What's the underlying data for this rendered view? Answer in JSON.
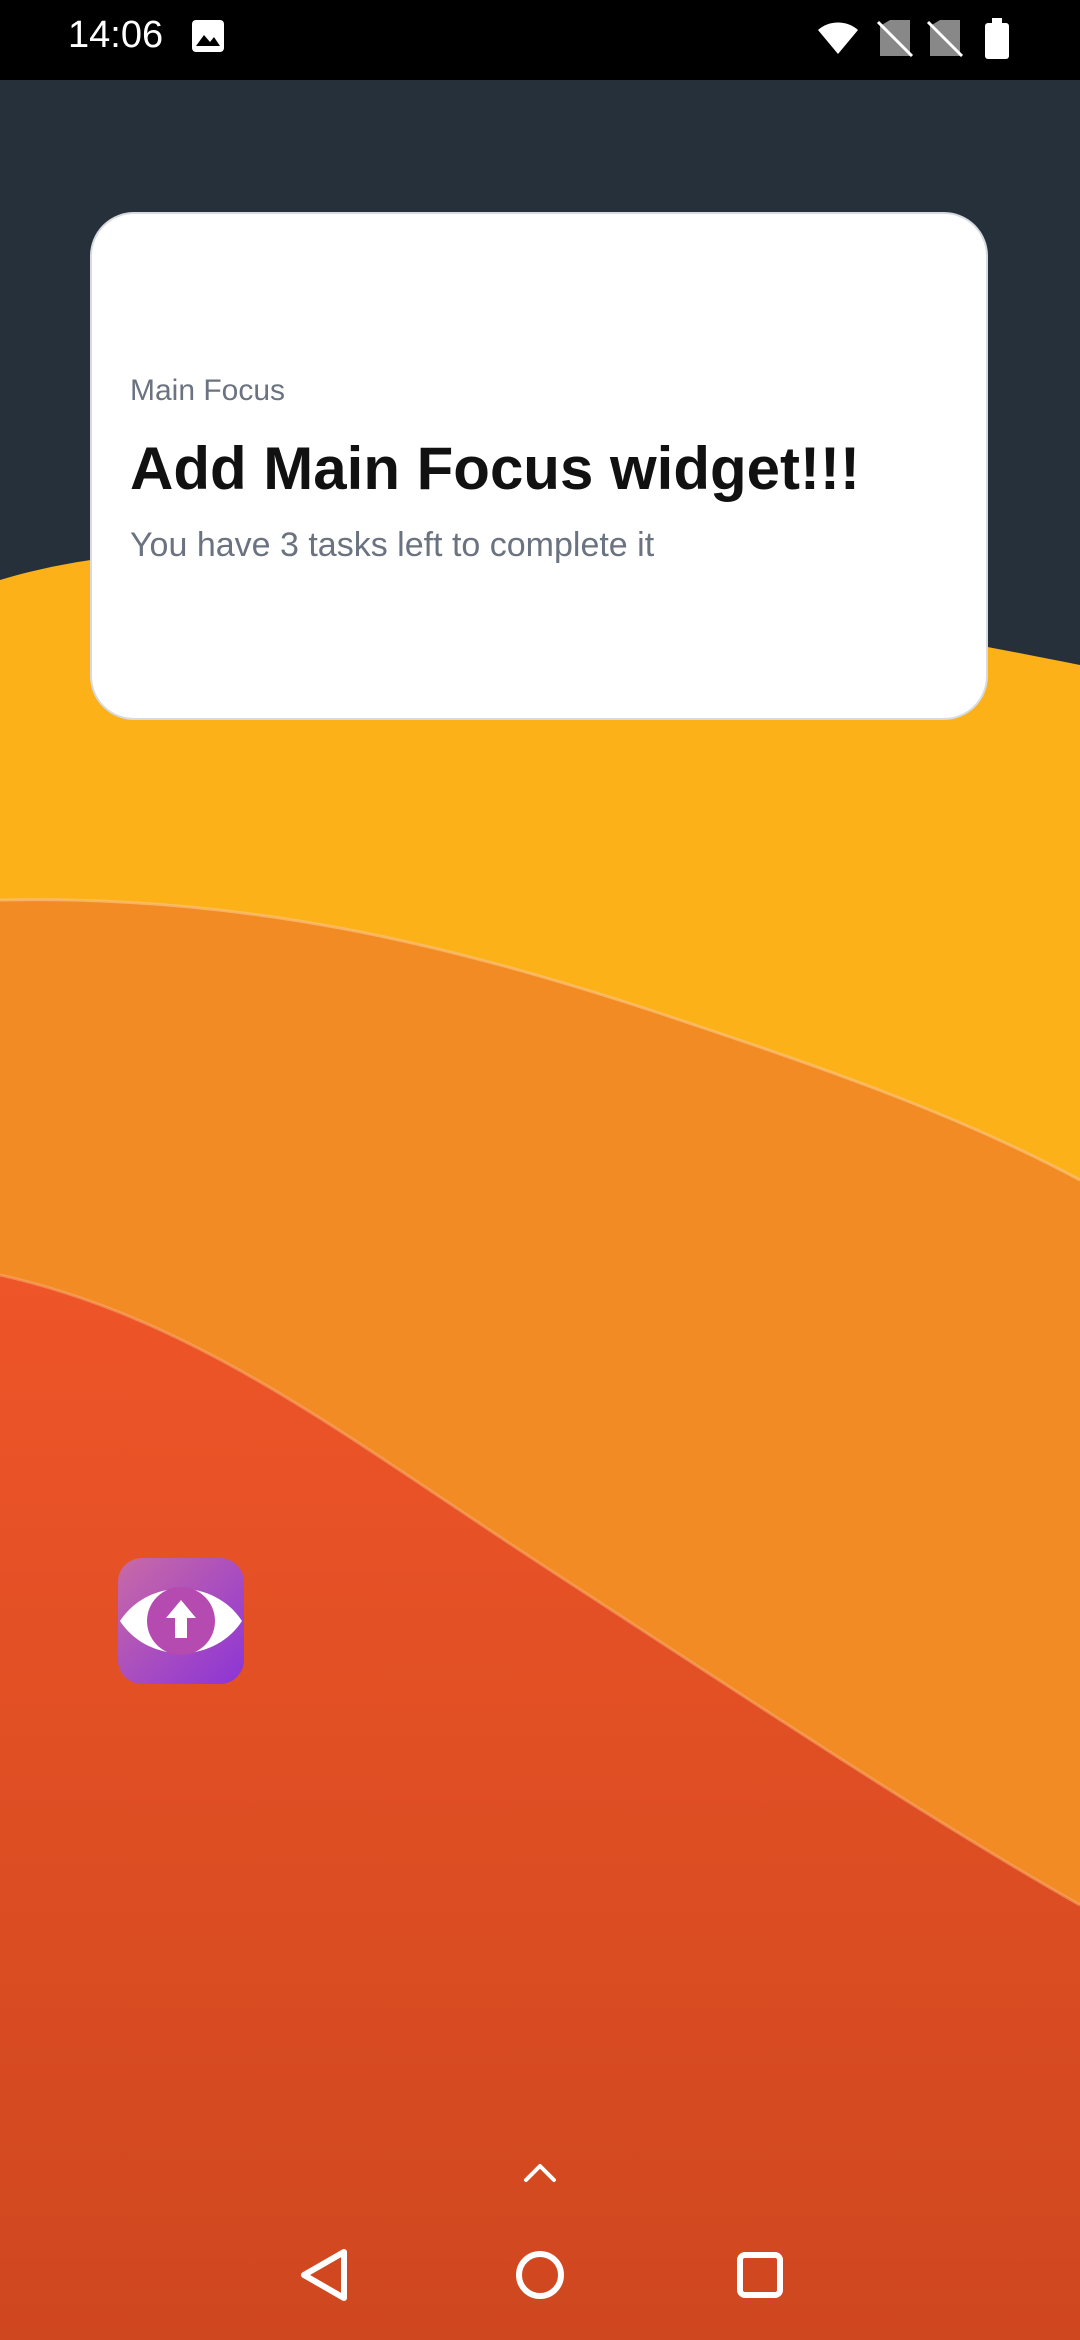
{
  "status_bar": {
    "time": "14:06",
    "icons": [
      "image-icon",
      "wifi-icon",
      "no-sim-icon",
      "no-sim-icon",
      "battery-icon"
    ]
  },
  "widget": {
    "label": "Main Focus",
    "title": "Add Main Focus widget!!!",
    "subtitle": "You have 3 tasks left to complete it"
  },
  "home": {
    "app_icon": "eye-upload-app-icon"
  },
  "nav_bar": {
    "icons": [
      "back-icon",
      "home-icon",
      "recents-icon"
    ]
  },
  "colors": {
    "dark": "#25303a",
    "yellow": "#fbb117",
    "orange": "#f38b24",
    "red": "#ee5528"
  }
}
